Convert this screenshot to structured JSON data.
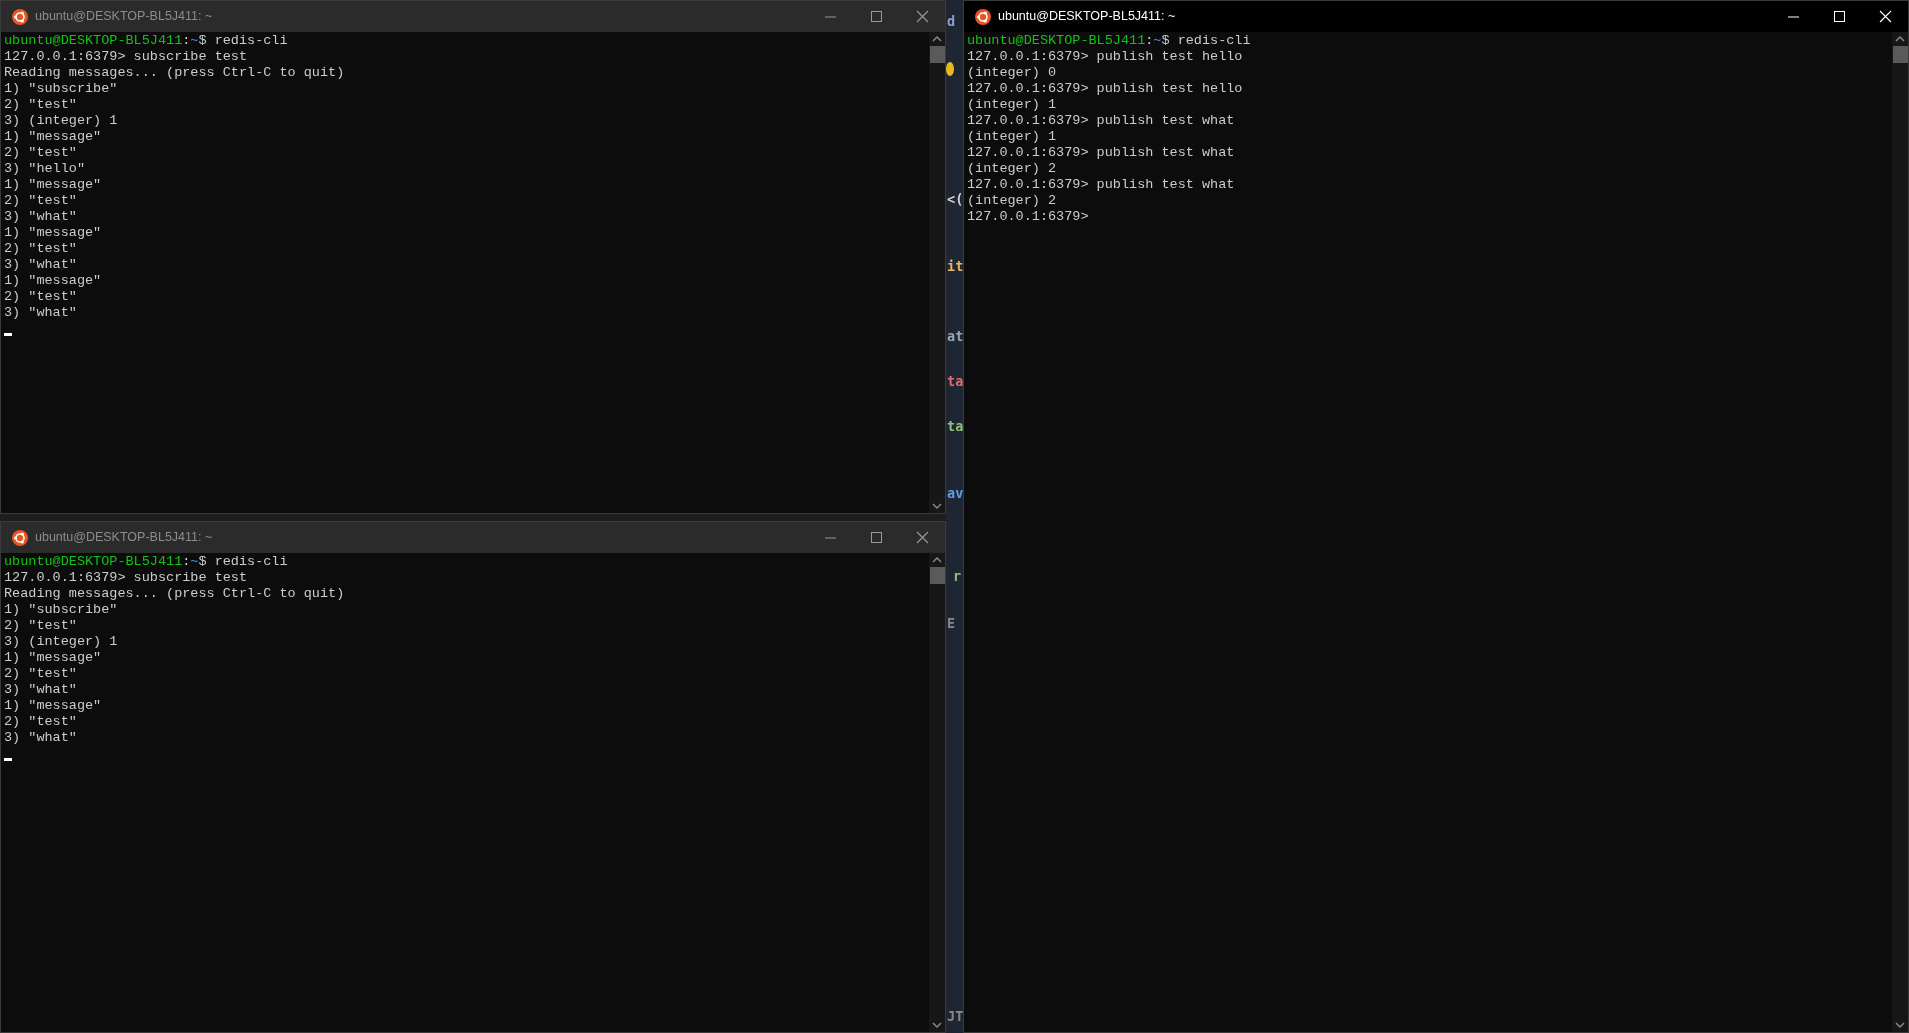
{
  "windows": [
    {
      "title": "ubuntu@DESKTOP-BL5J411: ~",
      "active": false,
      "cursor": true,
      "lines": [
        {
          "kind": "prompt",
          "user_host": "ubuntu@DESKTOP-BL5J411",
          "sep": ":",
          "path": "~",
          "command": "$ redis-cli"
        },
        {
          "kind": "output",
          "text": "127.0.0.1:6379> subscribe test"
        },
        {
          "kind": "output",
          "text": "Reading messages... (press Ctrl-C to quit)"
        },
        {
          "kind": "output",
          "text": "1) \"subscribe\""
        },
        {
          "kind": "output",
          "text": "2) \"test\""
        },
        {
          "kind": "output",
          "text": "3) (integer) 1"
        },
        {
          "kind": "output",
          "text": "1) \"message\""
        },
        {
          "kind": "output",
          "text": "2) \"test\""
        },
        {
          "kind": "output",
          "text": "3) \"hello\""
        },
        {
          "kind": "output",
          "text": "1) \"message\""
        },
        {
          "kind": "output",
          "text": "2) \"test\""
        },
        {
          "kind": "output",
          "text": "3) \"what\""
        },
        {
          "kind": "output",
          "text": "1) \"message\""
        },
        {
          "kind": "output",
          "text": "2) \"test\""
        },
        {
          "kind": "output",
          "text": "3) \"what\""
        },
        {
          "kind": "output",
          "text": "1) \"message\""
        },
        {
          "kind": "output",
          "text": "2) \"test\""
        },
        {
          "kind": "output",
          "text": "3) \"what\""
        }
      ]
    },
    {
      "title": "ubuntu@DESKTOP-BL5J411: ~",
      "active": false,
      "cursor": true,
      "lines": [
        {
          "kind": "prompt",
          "user_host": "ubuntu@DESKTOP-BL5J411",
          "sep": ":",
          "path": "~",
          "command": "$ redis-cli"
        },
        {
          "kind": "output",
          "text": "127.0.0.1:6379> subscribe test"
        },
        {
          "kind": "output",
          "text": "Reading messages... (press Ctrl-C to quit)"
        },
        {
          "kind": "output",
          "text": "1) \"subscribe\""
        },
        {
          "kind": "output",
          "text": "2) \"test\""
        },
        {
          "kind": "output",
          "text": "3) (integer) 1"
        },
        {
          "kind": "output",
          "text": "1) \"message\""
        },
        {
          "kind": "output",
          "text": "2) \"test\""
        },
        {
          "kind": "output",
          "text": "3) \"what\""
        },
        {
          "kind": "output",
          "text": "1) \"message\""
        },
        {
          "kind": "output",
          "text": "2) \"test\""
        },
        {
          "kind": "output",
          "text": "3) \"what\""
        }
      ]
    },
    {
      "title": "ubuntu@DESKTOP-BL5J411: ~",
      "active": true,
      "cursor": false,
      "lines": [
        {
          "kind": "prompt",
          "user_host": "ubuntu@DESKTOP-BL5J411",
          "sep": ":",
          "path": "~",
          "command": "$ redis-cli"
        },
        {
          "kind": "output",
          "text": "127.0.0.1:6379> publish test hello"
        },
        {
          "kind": "output",
          "text": "(integer) 0"
        },
        {
          "kind": "output",
          "text": "127.0.0.1:6379> publish test hello"
        },
        {
          "kind": "output",
          "text": "(integer) 1"
        },
        {
          "kind": "output",
          "text": "127.0.0.1:6379> publish test what"
        },
        {
          "kind": "output",
          "text": "(integer) 1"
        },
        {
          "kind": "output",
          "text": "127.0.0.1:6379> publish test what"
        },
        {
          "kind": "output",
          "text": "(integer) 2"
        },
        {
          "kind": "output",
          "text": "127.0.0.1:6379> publish test what"
        },
        {
          "kind": "output",
          "text": "(integer) 2"
        },
        {
          "kind": "output",
          "text": "127.0.0.1:6379>"
        }
      ]
    }
  ],
  "editor_fragments": [
    {
      "text": "d",
      "color": "#8aa4c8"
    },
    {
      "text": "<(",
      "color": "#d4d4d4"
    },
    {
      "text": "it",
      "color": "#e5b567"
    },
    {
      "text": "at",
      "color": "#9aa7b8"
    },
    {
      "text": "ta",
      "color": "#e06c6c"
    },
    {
      "text": "ta",
      "color": "#8fc27a"
    },
    {
      "text": "av",
      "color": "#5aa0e6"
    },
    {
      "text": "r",
      "color": "#8fc27a"
    },
    {
      "text": "E",
      "color": "#8a8a8a"
    },
    {
      "text": "JT",
      "color": "#8a8a8a"
    }
  ]
}
